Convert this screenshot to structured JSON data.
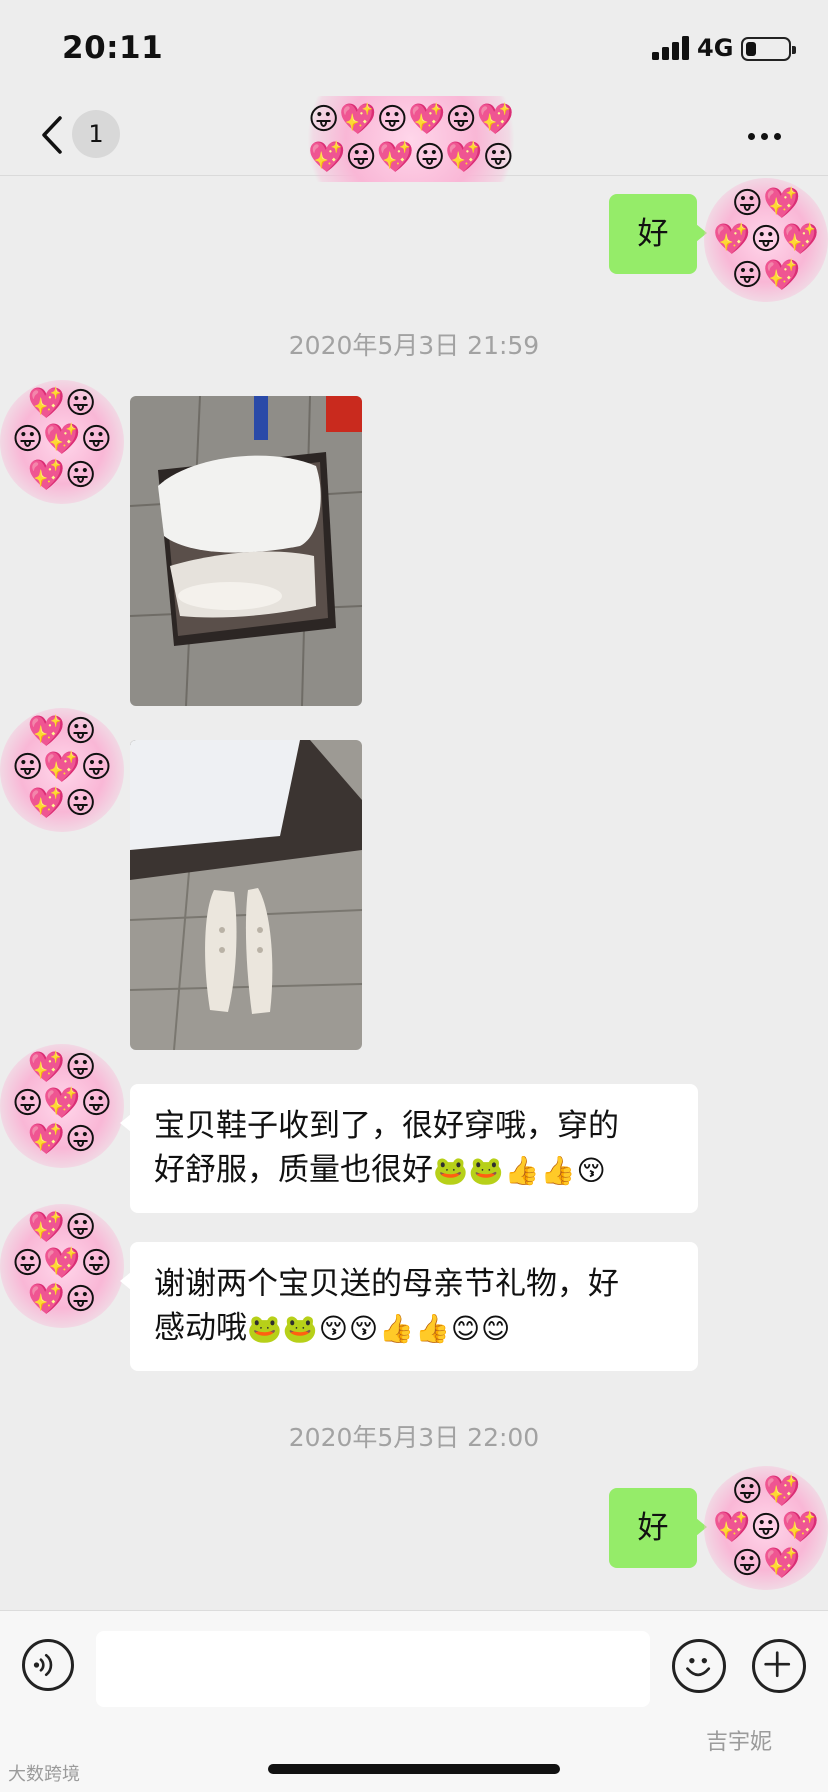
{
  "status_bar": {
    "time": "20:11",
    "network": "4G",
    "battery_level": 0.25
  },
  "nav": {
    "unread_count": "1",
    "back_icon": "chevron-left-icon",
    "more_icon": "ellipsis-icon"
  },
  "avatar_emoji": {
    "face": "😛",
    "heart": "💖"
  },
  "messages": {
    "out_1": "好",
    "time_1": "2020年5月3日 21:59",
    "in_text_1_line1": "宝贝鞋子收到了，很好穿哦，穿的",
    "in_text_1_line2": "好舒服，质量也很好",
    "in_text_1_emoji": "🐸🐸👍👍😚",
    "in_text_2_line1": "谢谢两个宝贝送的母亲节礼物，好",
    "in_text_2_line2": "感动哦",
    "in_text_2_emoji": "🐸🐸😚😚👍👍😊😊",
    "time_2": "2020年5月3日 22:00",
    "out_2": "好"
  },
  "input": {
    "placeholder": ""
  },
  "watermarks": {
    "left": "大数跨境",
    "right": "吉宇妮"
  },
  "colors": {
    "background": "#ededed",
    "outgoing_bubble": "#95ec69",
    "incoming_bubble": "#ffffff",
    "timestamp": "#a2a2a2"
  }
}
